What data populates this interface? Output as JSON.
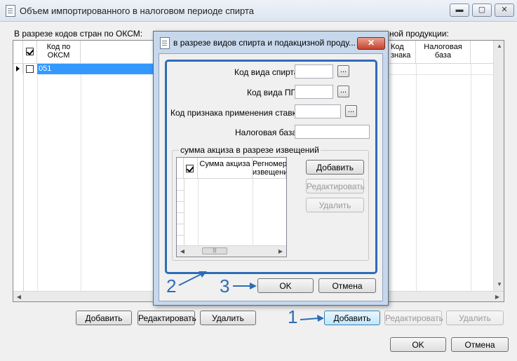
{
  "window": {
    "title": "Объем импортированного в налоговом периоде спирта",
    "controls": [
      "minimize",
      "maximize",
      "close"
    ]
  },
  "left_grid": {
    "caption": "В разрезе кодов стран по ОКСМ:",
    "col_code_line1": "Код по",
    "col_code_line2": "ОКСМ",
    "rows": [
      {
        "code": "051"
      }
    ]
  },
  "right_grid": {
    "caption_fragment": "ной продукции:",
    "col_priznak_line1": "Код",
    "col_priznak_line2": "знака",
    "col_base_line1": "Налоговая",
    "col_base_line2": "база"
  },
  "left_buttons": {
    "add": "Добавить",
    "edit": "Редактировать",
    "delete": "Удалить"
  },
  "right_buttons": {
    "add": "Добавить",
    "edit": "Редактировать",
    "delete": "Удалить"
  },
  "footer": {
    "ok": "OK",
    "cancel": "Отмена"
  },
  "dialog": {
    "title": "в разрезе видов спирта и подакцизной проду...",
    "close": "✕",
    "fields": {
      "spirit_label": "Код вида спирта",
      "pp_label": "Код вида ПП",
      "rate_label": "Код признака применения ставки",
      "base_label": "Налоговая база",
      "browse": "..."
    },
    "group": {
      "label": "сумма акциза в разрезе извещений",
      "col_sum": "Сумма акциза",
      "col_reg_line1": "Регномер",
      "col_reg_line2": "извещения",
      "add": "Добавить",
      "edit": "Редактировать",
      "delete": "Удалить"
    },
    "ok": "OK",
    "cancel": "Отмена"
  },
  "annotations": {
    "one": "1",
    "two": "2",
    "three": "3"
  },
  "colors": {
    "annotation": "#2d6db6",
    "selection": "#3399ff",
    "dialog_frame": "#c7d8ec"
  }
}
